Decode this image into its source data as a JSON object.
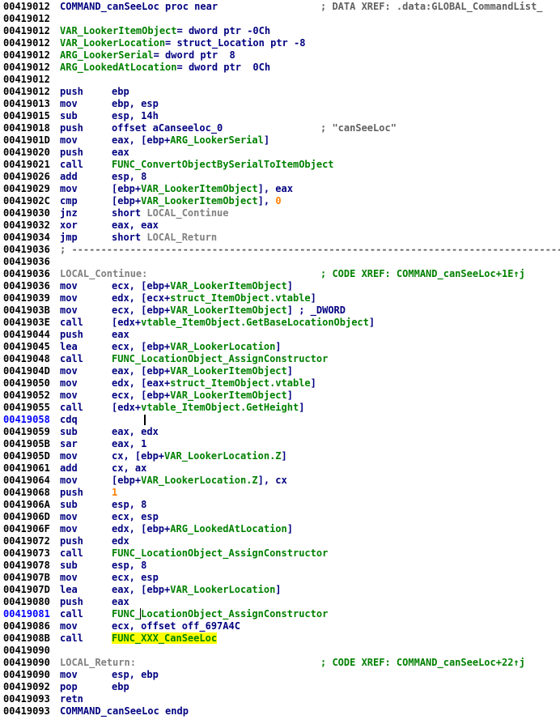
{
  "lines": [
    {
      "addr": "00419012",
      "kind": "label",
      "parts": [
        [
          "COMMAND_canSeeLoc proc near",
          "k"
        ]
      ],
      "comment": "; DATA XREF: .data:GLOBAL_CommandList_",
      "comment_color": "gray"
    },
    {
      "addr": "00419012",
      "kind": "blank"
    },
    {
      "addr": "00419012",
      "kind": "label",
      "parts": [
        [
          "VAR_LookerItemObject",
          "g"
        ],
        [
          "= dword ptr -0Ch",
          "k"
        ]
      ]
    },
    {
      "addr": "00419012",
      "kind": "label",
      "parts": [
        [
          "VAR_LookerLocation",
          "g"
        ],
        [
          "= struct_Location ptr -8",
          "k"
        ]
      ]
    },
    {
      "addr": "00419012",
      "kind": "label",
      "parts": [
        [
          "ARG_LookerSerial",
          "g"
        ],
        [
          "= dword ptr  8",
          "k"
        ]
      ]
    },
    {
      "addr": "00419012",
      "kind": "label",
      "parts": [
        [
          "ARG_LookedAtLocation",
          "g"
        ],
        [
          "= dword ptr  0Ch",
          "k"
        ]
      ]
    },
    {
      "addr": "00419012",
      "kind": "blank"
    },
    {
      "addr": "00419012",
      "kind": "ins",
      "mn": "push",
      "ops": [
        [
          "ebp",
          "k"
        ]
      ]
    },
    {
      "addr": "00419013",
      "kind": "ins",
      "mn": "mov",
      "ops": [
        [
          "ebp, esp",
          "k"
        ]
      ]
    },
    {
      "addr": "00419015",
      "kind": "ins",
      "mn": "sub",
      "ops": [
        [
          "esp, 14h",
          "k"
        ]
      ]
    },
    {
      "addr": "00419018",
      "kind": "ins",
      "mn": "push",
      "ops": [
        [
          "offset aCanseeloc_0",
          "k"
        ]
      ],
      "comment": "; \"canSeeLoc\"",
      "comment_color": "gray"
    },
    {
      "addr": "0041901D",
      "kind": "ins",
      "mn": "mov",
      "ops": [
        [
          "eax, [ebp+",
          "k"
        ],
        [
          "ARG_LookerSerial",
          "g"
        ],
        [
          "]",
          "k"
        ]
      ]
    },
    {
      "addr": "00419020",
      "kind": "ins",
      "mn": "push",
      "ops": [
        [
          "eax",
          "k"
        ]
      ]
    },
    {
      "addr": "00419021",
      "kind": "ins",
      "mn": "call",
      "ops": [
        [
          "FUNC_ConvertObjectBySerialToItemObject",
          "g"
        ]
      ]
    },
    {
      "addr": "00419026",
      "kind": "ins",
      "mn": "add",
      "ops": [
        [
          "esp, 8",
          "k"
        ]
      ]
    },
    {
      "addr": "00419029",
      "kind": "ins",
      "mn": "mov",
      "ops": [
        [
          "[ebp+",
          "k"
        ],
        [
          "VAR_LookerItemObject",
          "g"
        ],
        [
          "], eax",
          "k"
        ]
      ]
    },
    {
      "addr": "0041902C",
      "kind": "ins",
      "mn": "cmp",
      "ops": [
        [
          "[ebp+",
          "k"
        ],
        [
          "VAR_LookerItemObject",
          "g"
        ],
        [
          "], ",
          "k"
        ],
        [
          "0",
          "o"
        ]
      ]
    },
    {
      "addr": "00419030",
      "kind": "ins",
      "mn": "jnz",
      "ops": [
        [
          "short ",
          "k"
        ],
        [
          "LOCAL_Continue",
          "gray"
        ]
      ]
    },
    {
      "addr": "00419032",
      "kind": "ins",
      "mn": "xor",
      "ops": [
        [
          "eax, eax",
          "k"
        ]
      ]
    },
    {
      "addr": "00419034",
      "kind": "ins",
      "mn": "jmp",
      "ops": [
        [
          "short ",
          "k"
        ],
        [
          "LOCAL_Return",
          "gray"
        ]
      ]
    },
    {
      "addr": "00419036",
      "kind": "sep",
      "text": "; -------------------------------------------------------------------------------------------------------------"
    },
    {
      "addr": "00419036",
      "kind": "blank"
    },
    {
      "addr": "00419036",
      "kind": "label",
      "parts": [
        [
          "LOCAL_Continue:",
          "gray"
        ]
      ],
      "comment": "; CODE XREF: COMMAND_canSeeLoc+1E↑j",
      "comment_color": "green"
    },
    {
      "addr": "00419036",
      "kind": "ins",
      "mn": "mov",
      "ops": [
        [
          "ecx, [ebp+",
          "k"
        ],
        [
          "VAR_LookerItemObject",
          "g"
        ],
        [
          "]",
          "k"
        ]
      ]
    },
    {
      "addr": "00419039",
      "kind": "ins",
      "mn": "mov",
      "ops": [
        [
          "edx, [ecx+",
          "k"
        ],
        [
          "struct_ItemObject.vtable",
          "g"
        ],
        [
          "]",
          "k"
        ]
      ]
    },
    {
      "addr": "0041903B",
      "kind": "ins",
      "mn": "mov",
      "ops": [
        [
          "ecx, [ebp+",
          "k"
        ],
        [
          "VAR_LookerItemObject",
          "g"
        ],
        [
          "] ; _DWORD",
          "k"
        ]
      ]
    },
    {
      "addr": "0041903E",
      "kind": "ins",
      "mn": "call",
      "ops": [
        [
          "[edx+",
          "k"
        ],
        [
          "vtable_ItemObject.GetBaseLocationObject",
          "g"
        ],
        [
          "]",
          "k"
        ]
      ]
    },
    {
      "addr": "00419044",
      "kind": "ins",
      "mn": "push",
      "ops": [
        [
          "eax",
          "k"
        ]
      ]
    },
    {
      "addr": "00419045",
      "kind": "ins",
      "mn": "lea",
      "ops": [
        [
          "ecx, [ebp+",
          "k"
        ],
        [
          "VAR_LookerLocation",
          "g"
        ],
        [
          "]",
          "k"
        ]
      ]
    },
    {
      "addr": "00419048",
      "kind": "ins",
      "mn": "call",
      "ops": [
        [
          "FUNC_LocationObject_AssignConstructor",
          "g"
        ]
      ]
    },
    {
      "addr": "0041904D",
      "kind": "ins",
      "mn": "mov",
      "ops": [
        [
          "eax, [ebp+",
          "k"
        ],
        [
          "VAR_LookerItemObject",
          "g"
        ],
        [
          "]",
          "k"
        ]
      ]
    },
    {
      "addr": "00419050",
      "kind": "ins",
      "mn": "mov",
      "ops": [
        [
          "edx, [eax+",
          "k"
        ],
        [
          "struct_ItemObject.vtable",
          "g"
        ],
        [
          "]",
          "k"
        ]
      ]
    },
    {
      "addr": "00419052",
      "kind": "ins",
      "mn": "mov",
      "ops": [
        [
          "ecx, [ebp+",
          "k"
        ],
        [
          "VAR_LookerItemObject",
          "g"
        ],
        [
          "]",
          "k"
        ]
      ]
    },
    {
      "addr": "00419055",
      "kind": "ins",
      "mn": "call",
      "ops": [
        [
          "[edx+",
          "k"
        ],
        [
          "vtable_ItemObject.GetHeight",
          "g"
        ],
        [
          "]",
          "k"
        ]
      ]
    },
    {
      "addr": "00419058",
      "kind": "ins",
      "mn": "cdq",
      "ops": [],
      "addr_hi": true,
      "cursor": true
    },
    {
      "addr": "00419059",
      "kind": "ins",
      "mn": "sub",
      "ops": [
        [
          "eax, edx",
          "k"
        ]
      ]
    },
    {
      "addr": "0041905B",
      "kind": "ins",
      "mn": "sar",
      "ops": [
        [
          "eax, 1",
          "k"
        ]
      ]
    },
    {
      "addr": "0041905D",
      "kind": "ins",
      "mn": "mov",
      "ops": [
        [
          "cx, [ebp+",
          "k"
        ],
        [
          "VAR_LookerLocation.Z",
          "g"
        ],
        [
          "]",
          "k"
        ]
      ]
    },
    {
      "addr": "00419061",
      "kind": "ins",
      "mn": "add",
      "ops": [
        [
          "cx, ax",
          "k"
        ]
      ]
    },
    {
      "addr": "00419064",
      "kind": "ins",
      "mn": "mov",
      "ops": [
        [
          "[ebp+",
          "k"
        ],
        [
          "VAR_LookerLocation.Z",
          "g"
        ],
        [
          "], cx",
          "k"
        ]
      ]
    },
    {
      "addr": "00419068",
      "kind": "ins",
      "mn": "push",
      "ops": [
        [
          "1",
          "o"
        ]
      ]
    },
    {
      "addr": "0041906A",
      "kind": "ins",
      "mn": "sub",
      "ops": [
        [
          "esp, 8",
          "k"
        ]
      ]
    },
    {
      "addr": "0041906D",
      "kind": "ins",
      "mn": "mov",
      "ops": [
        [
          "ecx, esp",
          "k"
        ]
      ]
    },
    {
      "addr": "0041906F",
      "kind": "ins",
      "mn": "mov",
      "ops": [
        [
          "edx, [ebp+",
          "k"
        ],
        [
          "ARG_LookedAtLocation",
          "g"
        ],
        [
          "]",
          "k"
        ]
      ]
    },
    {
      "addr": "00419072",
      "kind": "ins",
      "mn": "push",
      "ops": [
        [
          "edx",
          "k"
        ]
      ]
    },
    {
      "addr": "00419073",
      "kind": "ins",
      "mn": "call",
      "ops": [
        [
          "FUNC_LocationObject_AssignConstructor",
          "g"
        ]
      ]
    },
    {
      "addr": "00419078",
      "kind": "ins",
      "mn": "sub",
      "ops": [
        [
          "esp, 8",
          "k"
        ]
      ]
    },
    {
      "addr": "0041907B",
      "kind": "ins",
      "mn": "mov",
      "ops": [
        [
          "ecx, esp",
          "k"
        ]
      ]
    },
    {
      "addr": "0041907D",
      "kind": "ins",
      "mn": "lea",
      "ops": [
        [
          "eax, [ebp+",
          "k"
        ],
        [
          "VAR_LookerLocation",
          "g"
        ],
        [
          "]",
          "k"
        ]
      ]
    },
    {
      "addr": "00419080",
      "kind": "ins",
      "mn": "push",
      "ops": [
        [
          "eax",
          "k"
        ]
      ]
    },
    {
      "addr": "00419081",
      "kind": "ins",
      "mn": "call",
      "ops": [
        [
          "FUNC_",
          "g"
        ],
        [
          "LocationObject_AssignConstructor",
          "g-cur"
        ]
      ],
      "addr_hi": true
    },
    {
      "addr": "00419086",
      "kind": "ins",
      "mn": "mov",
      "ops": [
        [
          "ecx, offset off_697A4C",
          "k"
        ]
      ]
    },
    {
      "addr": "0041908B",
      "kind": "ins",
      "mn": "call",
      "ops": [
        [
          "FUNC_XXX_CanSeeLoc",
          "hl"
        ]
      ]
    },
    {
      "addr": "00419090",
      "kind": "blank"
    },
    {
      "addr": "00419090",
      "kind": "label",
      "parts": [
        [
          "LOCAL_Return:",
          "gray"
        ]
      ],
      "comment": "; CODE XREF: COMMAND_canSeeLoc+22↑j",
      "comment_color": "green"
    },
    {
      "addr": "00419090",
      "kind": "ins",
      "mn": "mov",
      "ops": [
        [
          "esp, ebp",
          "k"
        ]
      ]
    },
    {
      "addr": "00419092",
      "kind": "ins",
      "mn": "pop",
      "ops": [
        [
          "ebp",
          "k"
        ]
      ]
    },
    {
      "addr": "00419093",
      "kind": "ins",
      "mn": "retn",
      "ops": []
    },
    {
      "addr": "00419093",
      "kind": "label",
      "parts": [
        [
          "COMMAND_canSeeLoc endp",
          "k"
        ]
      ]
    }
  ],
  "colors": {
    "background": "#ffffff",
    "address": "#000000",
    "address_highlight": "#0000ff",
    "instruction": "#000080",
    "name": "#008000",
    "label": "#808080",
    "constant": "#ff8000",
    "highlight_bg": "#ffff00"
  }
}
